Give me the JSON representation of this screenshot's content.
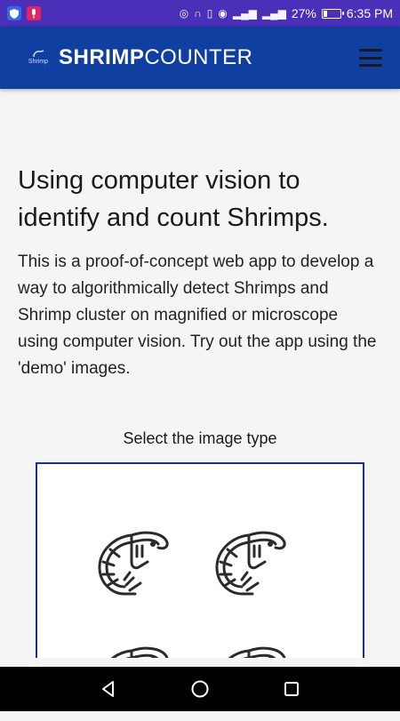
{
  "status_bar": {
    "battery_percent": "27%",
    "time": "6:35 PM",
    "battery_level": 0.27,
    "bg_color": "#4a2fb8"
  },
  "app_bar": {
    "brand_bold": "SHRIMP",
    "brand_light": "COUNTER",
    "logo_text": "Shrimp",
    "bg_color": "#0f3fa0",
    "menu_icon": "hamburger-menu-icon"
  },
  "main": {
    "headline": "Using computer vision to identify and count Shrimps.",
    "intro": "This is a proof-of-concept web app to develop a way to algorithmically detect Shrimps and Shrimp cluster on magnified or microscope using computer vision. Try out the app using the 'demo' images.",
    "select_label": "Select the image type",
    "image_types": [
      {
        "icon": "shrimp-icon"
      },
      {
        "icon": "shrimp-icon"
      },
      {
        "icon": "shrimp-icon"
      },
      {
        "icon": "shrimp-icon"
      }
    ],
    "accent_color": "#16318a"
  },
  "nav_bar": {
    "buttons": [
      "back-icon",
      "home-icon",
      "recents-icon"
    ]
  }
}
